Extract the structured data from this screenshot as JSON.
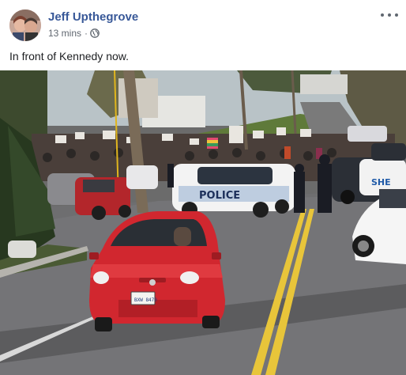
{
  "post": {
    "author": "Jeff Upthegrove",
    "timestamp": "13 mins",
    "separator": "·",
    "privacy_icon": "globe-icon",
    "more_icon": "more-options-icon",
    "text": "In front of Kennedy now."
  },
  "photo": {
    "police_car_text": "POLICE",
    "police_car_text_2": "SHE",
    "license_plate": "BXW 8470"
  },
  "colors": {
    "author_link": "#385898",
    "meta_gray": "#606770",
    "car_red": "#d1272f"
  }
}
